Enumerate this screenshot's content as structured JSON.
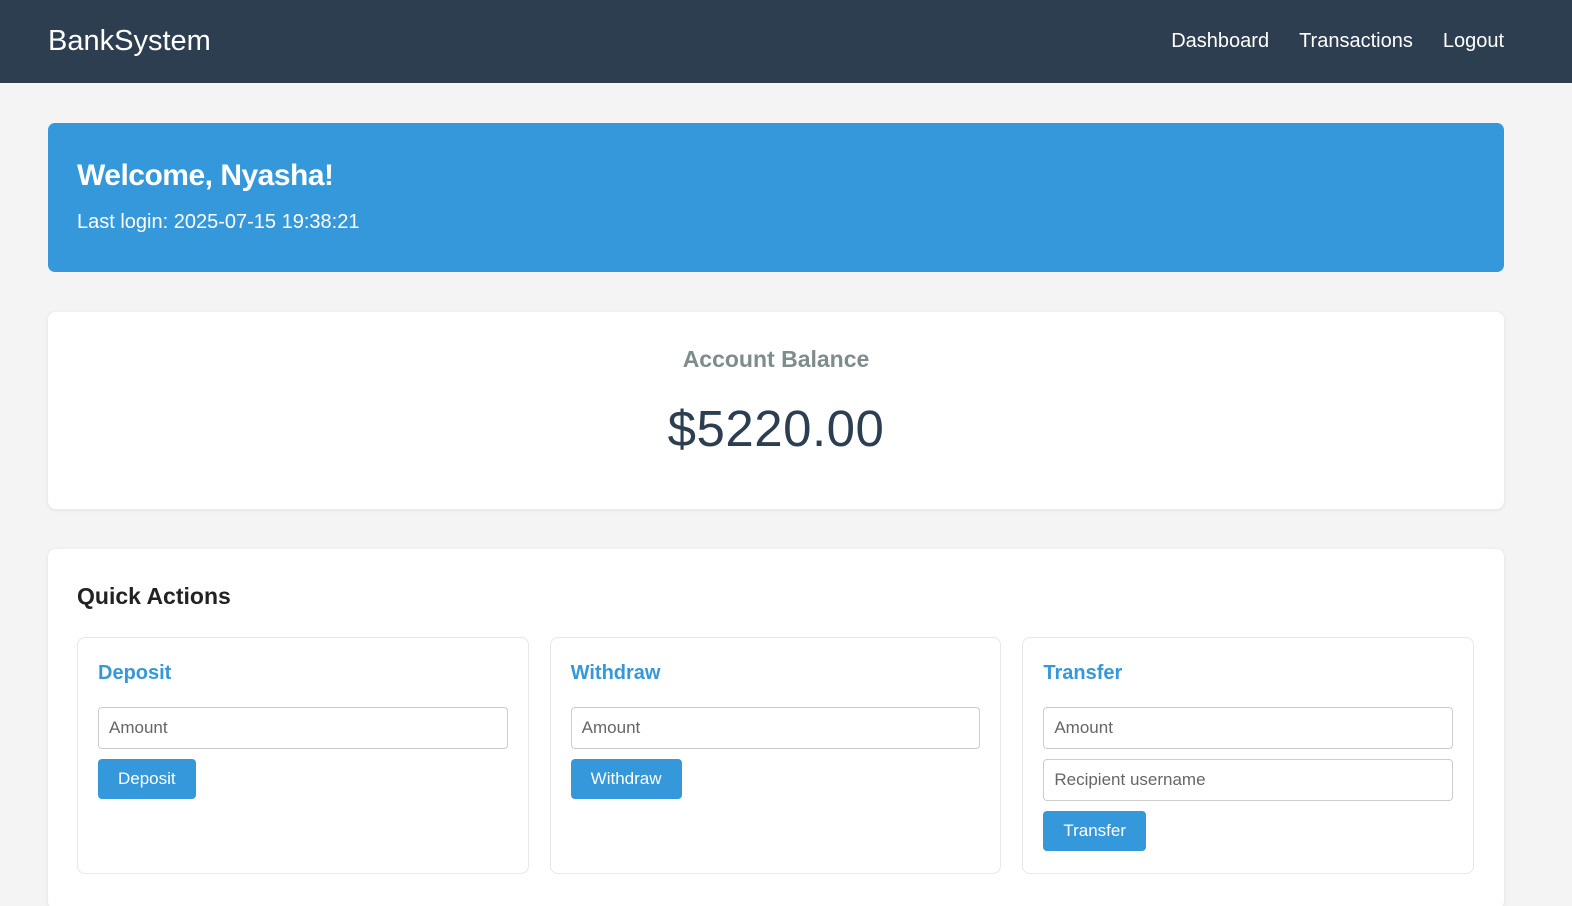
{
  "navbar": {
    "brand": "BankSystem",
    "links": [
      "Dashboard",
      "Transactions",
      "Logout"
    ]
  },
  "welcome": {
    "greeting": "Welcome, Nyasha!",
    "last_login": "Last login: 2025-07-15 19:38:21"
  },
  "balance": {
    "title": "Account Balance",
    "amount": "$5220.00"
  },
  "quick_actions": {
    "title": "Quick Actions",
    "deposit": {
      "title": "Deposit",
      "amount_placeholder": "Amount",
      "button": "Deposit"
    },
    "withdraw": {
      "title": "Withdraw",
      "amount_placeholder": "Amount",
      "button": "Withdraw"
    },
    "transfer": {
      "title": "Transfer",
      "amount_placeholder": "Amount",
      "recipient_placeholder": "Recipient username",
      "button": "Transfer"
    }
  },
  "colors": {
    "navbar": "#2d3e50",
    "accent": "#3498db",
    "background": "#f4f4f4"
  }
}
